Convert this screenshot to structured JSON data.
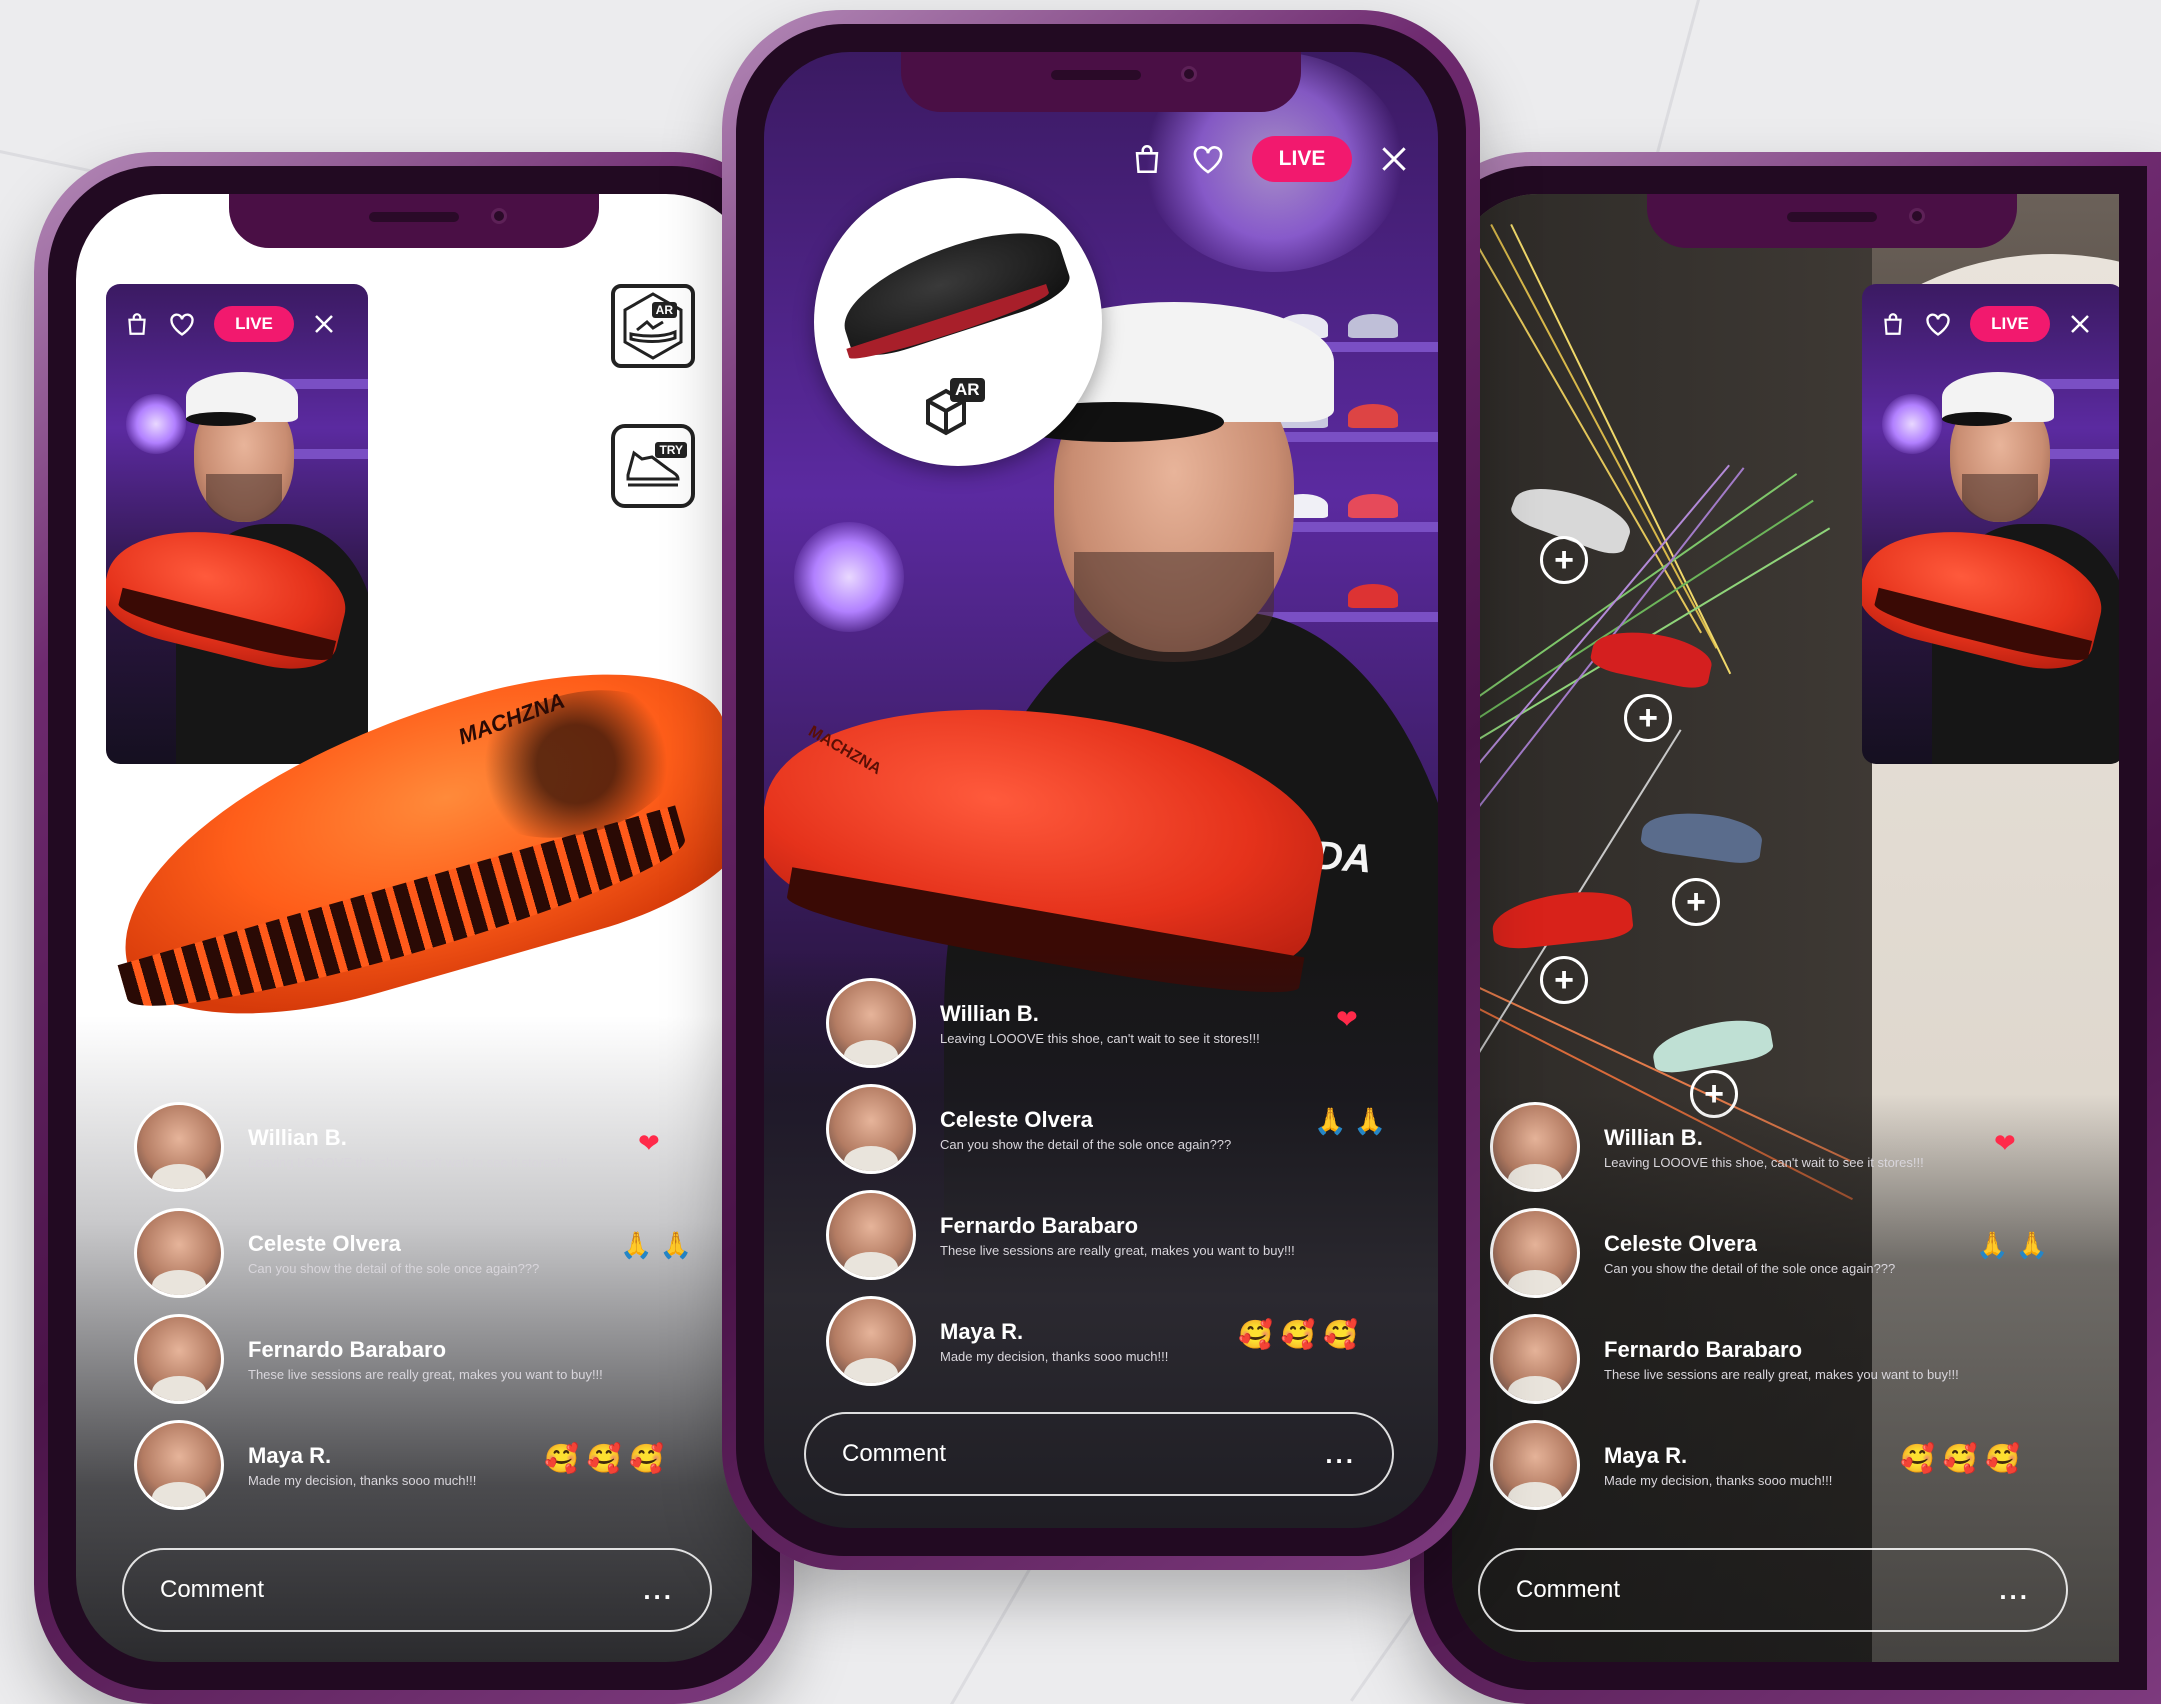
{
  "live_badge": "LIVE",
  "ar_label": "AR",
  "try_label": "TRY",
  "shoe_brand": "MACHZNA",
  "shirt_text": "CORIDA",
  "comment_placeholder": "Comment",
  "more_label": "...",
  "icons": [
    "bag-icon",
    "heart-icon",
    "close-icon",
    "ar-shoe-icon",
    "try-shoe-icon",
    "plus-icon"
  ],
  "colors": {
    "live": "#f2196e",
    "phone_frame": "#5a1a58",
    "heart": "#ff2a4a"
  },
  "comments": [
    {
      "name": "Willian B.",
      "text": "Leaving LOOOVE this shoe, can't wait to see it stores!!!",
      "emoji": "❤"
    },
    {
      "name": "Celeste Olvera",
      "text": "Can you show the detail of the sole once again???",
      "emoji": "🙏 🙏"
    },
    {
      "name": "Fernardo Barabaro",
      "text": "These live sessions are really great, makes you want to buy!!!",
      "emoji": ""
    },
    {
      "name": "Maya R.",
      "text": "Made my decision, thanks sooo much!!!",
      "emoji": "🥰 🥰 🥰"
    }
  ]
}
